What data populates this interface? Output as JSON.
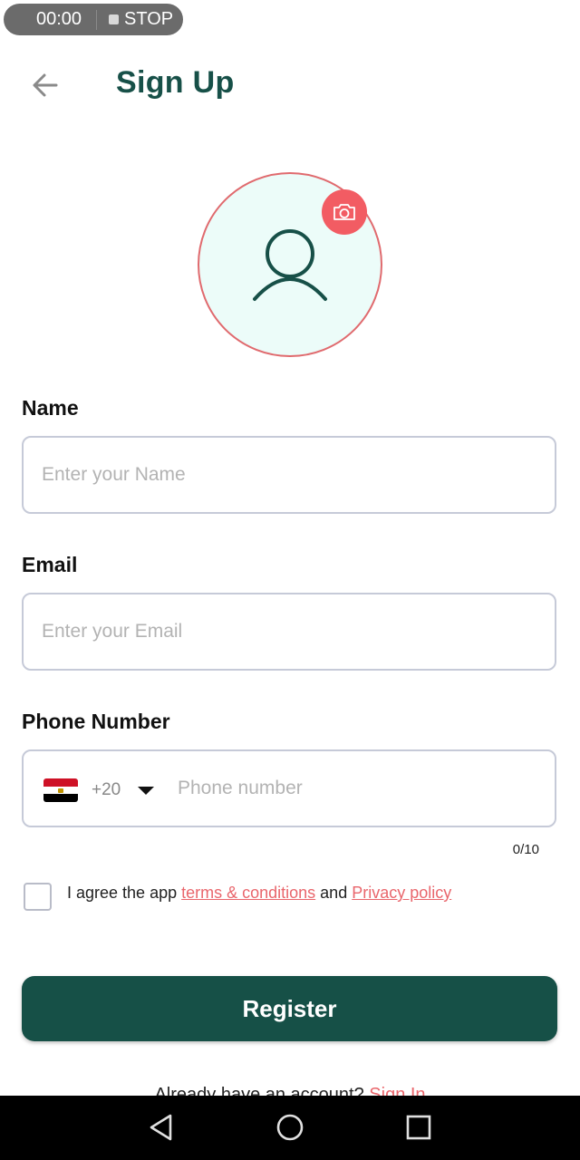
{
  "recorder": {
    "time": "00:00",
    "stop_label": "STOP"
  },
  "header": {
    "title": "Sign Up"
  },
  "form": {
    "name": {
      "label": "Name",
      "placeholder": "Enter your Name",
      "value": ""
    },
    "email": {
      "label": "Email",
      "placeholder": "Enter your Email",
      "value": ""
    },
    "phone": {
      "label": "Phone Number",
      "country_flag": "egypt-flag-icon",
      "dial_code": "+20",
      "placeholder": "Phone number",
      "value": "",
      "counter": "0/10"
    },
    "agreement": {
      "checked": false,
      "prefix": "I agree the app ",
      "terms_link": "terms & conditions",
      "middle": " and ",
      "privacy_link": "Privacy policy"
    },
    "register_label": "Register"
  },
  "footer": {
    "prompt": "Already have an account? ",
    "signin_link": "Sign In"
  },
  "colors": {
    "primary": "#165047",
    "accent": "#f25c63",
    "avatar_bg": "#ecfcf9",
    "field_border": "#c6cad8"
  },
  "icons": {
    "back": "arrow-left-icon",
    "avatar": "user-icon",
    "camera": "camera-icon",
    "dropdown": "caret-down-icon",
    "nav": [
      "back-triangle-icon",
      "home-circle-icon",
      "recents-square-icon"
    ]
  }
}
